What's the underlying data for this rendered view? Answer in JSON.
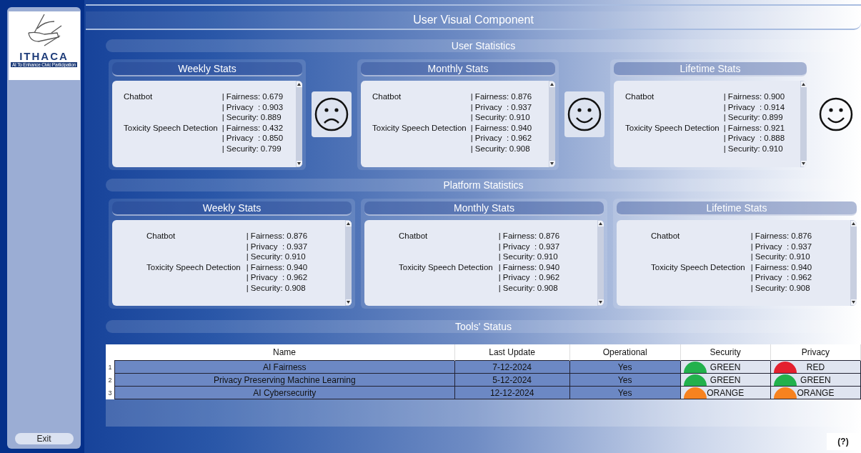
{
  "sidebar": {
    "logo_name": "ITHACA",
    "logo_tagline": "AI To Enhance Civic Participation",
    "exit_button": "Exit"
  },
  "title": "User Visual Component",
  "user_statistics": {
    "heading": "User Statistics",
    "panels": [
      {
        "title": "Weekly Stats",
        "kind": "sad",
        "models": [
          {
            "name": "Chatbot",
            "metrics": [
              "| Fairness: 0.679",
              "| Privacy  : 0.903",
              "| Security: 0.889"
            ]
          },
          {
            "name": "Toxicity Speech Detection",
            "metrics": [
              "| Fairness: 0.432",
              "| Privacy  : 0.850",
              "| Security: 0.799"
            ]
          }
        ]
      },
      {
        "title": "Monthly Stats",
        "kind": "happy",
        "models": [
          {
            "name": "Chatbot",
            "metrics": [
              "| Fairness: 0.876",
              "| Privacy  : 0.937",
              "| Security: 0.910"
            ]
          },
          {
            "name": "Toxicity Speech Detection",
            "metrics": [
              "| Fairness: 0.940",
              "| Privacy  : 0.962",
              "| Security: 0.908"
            ]
          }
        ]
      },
      {
        "title": "Lifetime Stats",
        "kind": "happy",
        "models": [
          {
            "name": "Chatbot",
            "metrics": [
              "| Fairness: 0.900",
              "| Privacy  : 0.914",
              "| Security: 0.899"
            ]
          },
          {
            "name": "Toxicity Speech Detection",
            "metrics": [
              "| Fairness: 0.921",
              "| Privacy  : 0.888",
              "| Security: 0.910"
            ]
          }
        ]
      }
    ]
  },
  "platform_statistics": {
    "heading": "Platform Statistics",
    "panels": [
      {
        "title": "Weekly Stats",
        "models": [
          {
            "name": "Chatbot",
            "metrics": [
              "| Fairness: 0.876",
              "| Privacy  : 0.937",
              "| Security: 0.910"
            ]
          },
          {
            "name": "Toxicity Speech Detection",
            "metrics": [
              "| Fairness: 0.940",
              "| Privacy  : 0.962",
              "| Security: 0.908"
            ]
          }
        ]
      },
      {
        "title": "Monthly Stats",
        "models": [
          {
            "name": "Chatbot",
            "metrics": [
              "| Fairness: 0.876",
              "| Privacy  : 0.937",
              "| Security: 0.910"
            ]
          },
          {
            "name": "Toxicity Speech Detection",
            "metrics": [
              "| Fairness: 0.940",
              "| Privacy  : 0.962",
              "| Security: 0.908"
            ]
          }
        ]
      },
      {
        "title": "Lifetime Stats",
        "models": [
          {
            "name": "Chatbot",
            "metrics": [
              "| Fairness: 0.876",
              "| Privacy  : 0.937",
              "| Security: 0.910"
            ]
          },
          {
            "name": "Toxicity Speech Detection",
            "metrics": [
              "| Fairness: 0.940",
              "| Privacy  : 0.962",
              "| Security: 0.908"
            ]
          }
        ]
      }
    ]
  },
  "tools_status": {
    "heading": "Tools' Status",
    "columns": [
      "Name",
      "Last Update",
      "Operational",
      "Security",
      "Privacy"
    ],
    "rows": [
      {
        "index": "1",
        "name": "AI Fairness",
        "last_update": "7-12-2024",
        "operational": "Yes",
        "security": {
          "label": "GREEN",
          "color": "#22b14c"
        },
        "privacy": {
          "label": "RED",
          "color": "#e3202e"
        }
      },
      {
        "index": "2",
        "name": "Privacy Preserving Machine Learning",
        "last_update": "5-12-2024",
        "operational": "Yes",
        "security": {
          "label": "GREEN",
          "color": "#22b14c"
        },
        "privacy": {
          "label": "GREEN",
          "color": "#22b14c"
        }
      },
      {
        "index": "3",
        "name": "AI Cybersecurity",
        "last_update": "12-12-2024",
        "operational": "Yes",
        "security": {
          "label": "ORANGE",
          "color": "#f7821f"
        },
        "privacy": {
          "label": "ORANGE",
          "color": "#f7821f"
        }
      }
    ]
  },
  "help_button": "(?)"
}
